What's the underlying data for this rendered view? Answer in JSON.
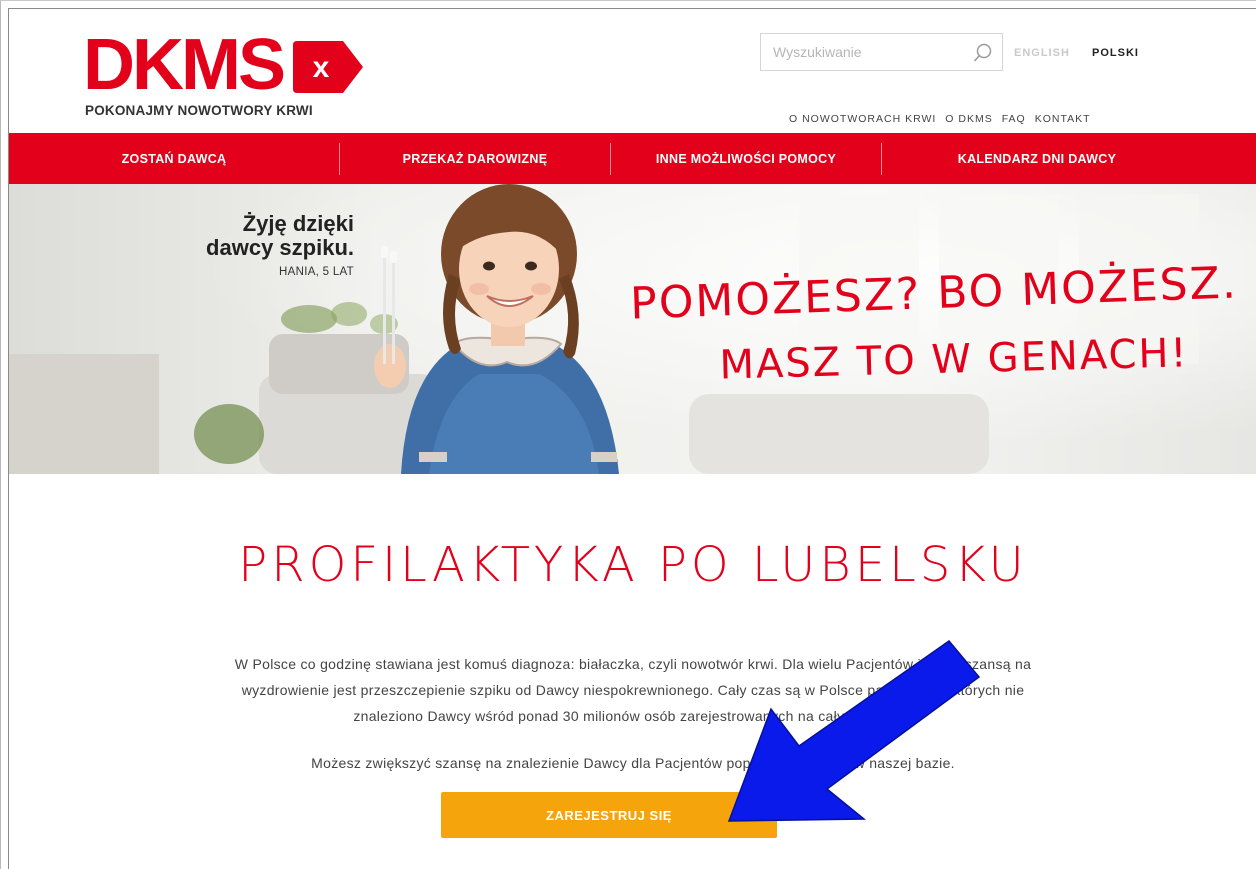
{
  "brand": {
    "logo_text": "DKMS",
    "badge_glyph": "x",
    "tagline": "POKONAJMY NOWOTWORY KRWI",
    "primary_color": "#e3001b"
  },
  "search": {
    "placeholder": "Wyszukiwanie",
    "icon": "search-icon"
  },
  "languages": {
    "english": "ENGLISH",
    "polish": "POLSKI"
  },
  "top_nav": [
    {
      "label": "O NOWOTWORACH KRWI"
    },
    {
      "label": "O DKMS"
    },
    {
      "label": "FAQ"
    },
    {
      "label": "KONTAKT"
    }
  ],
  "main_nav": [
    {
      "label": "ZOSTAŃ DAWCĄ"
    },
    {
      "label": "PRZEKAŻ DAROWIZNĘ"
    },
    {
      "label": "INNE MOŻLIWOŚCI POMOCY"
    },
    {
      "label": "KALENDARZ DNI DAWCY"
    }
  ],
  "hero": {
    "quote_line1": "Żyję dzięki",
    "quote_line2": "dawcy szpiku.",
    "quote_author": "HANIA, 5 LAT",
    "slogan_line1": "POMOŻESZ? BO MOŻESZ.",
    "slogan_line2": "MASZ TO W GENACH!"
  },
  "content": {
    "title": "PROFILAKTYKA PO LUBELSKU",
    "paragraph1_line1": "W Polsce co godzinę stawiana jest komuś diagnoza: białaczka, czyli nowotwór krwi. Dla wielu Pacjentów jedyną szansą na",
    "paragraph1_line2": "wyzdrowienie jest przeszczepienie szpiku od Dawcy niespokrewnionego. Cały czas są w Polsce pacjenci, dla których nie",
    "paragraph1_line3": "znaleziono Dawcy wśród ponad 30 milionów osób zarejestrowanych na całym świecie.",
    "paragraph2": "Możesz zwiększyć szansę na znalezienie Dawcy dla Pacjentów poprzez rejestrację w naszej bazie.",
    "cta_label": "ZAREJESTRUJ SIĘ",
    "cta_color": "#f5a50b"
  },
  "annotation": {
    "arrow_color": "#0a1aeb"
  }
}
